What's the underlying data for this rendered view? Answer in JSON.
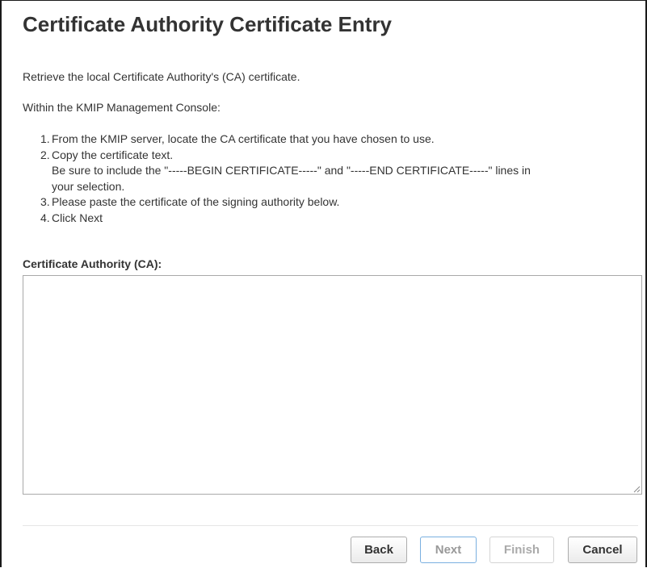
{
  "dialog": {
    "title": "Certificate Authority Certificate Entry",
    "intro": "Retrieve the local Certificate Authority's (CA) certificate.",
    "console_line": "Within the KMIP Management Console:",
    "steps": [
      {
        "num": "1.",
        "text": "From the KMIP server, locate the CA certificate that you have chosen to use."
      },
      {
        "num": "2.",
        "text": "Copy the certificate text.",
        "sub_line1": "Be sure to include the \"-----BEGIN CERTIFICATE-----\" and \"-----END CERTIFICATE-----\" lines in",
        "sub_line2": "your selection."
      },
      {
        "num": "3.",
        "text": "Please paste the certificate of the signing authority below."
      },
      {
        "num": "4.",
        "text": "Click Next"
      }
    ],
    "ca_field": {
      "label": "Certificate Authority (CA):",
      "value": ""
    },
    "buttons": {
      "back": "Back",
      "next": "Next",
      "finish": "Finish",
      "cancel": "Cancel"
    },
    "icons": {
      "resize_grip": "resize-grip-icon"
    }
  }
}
